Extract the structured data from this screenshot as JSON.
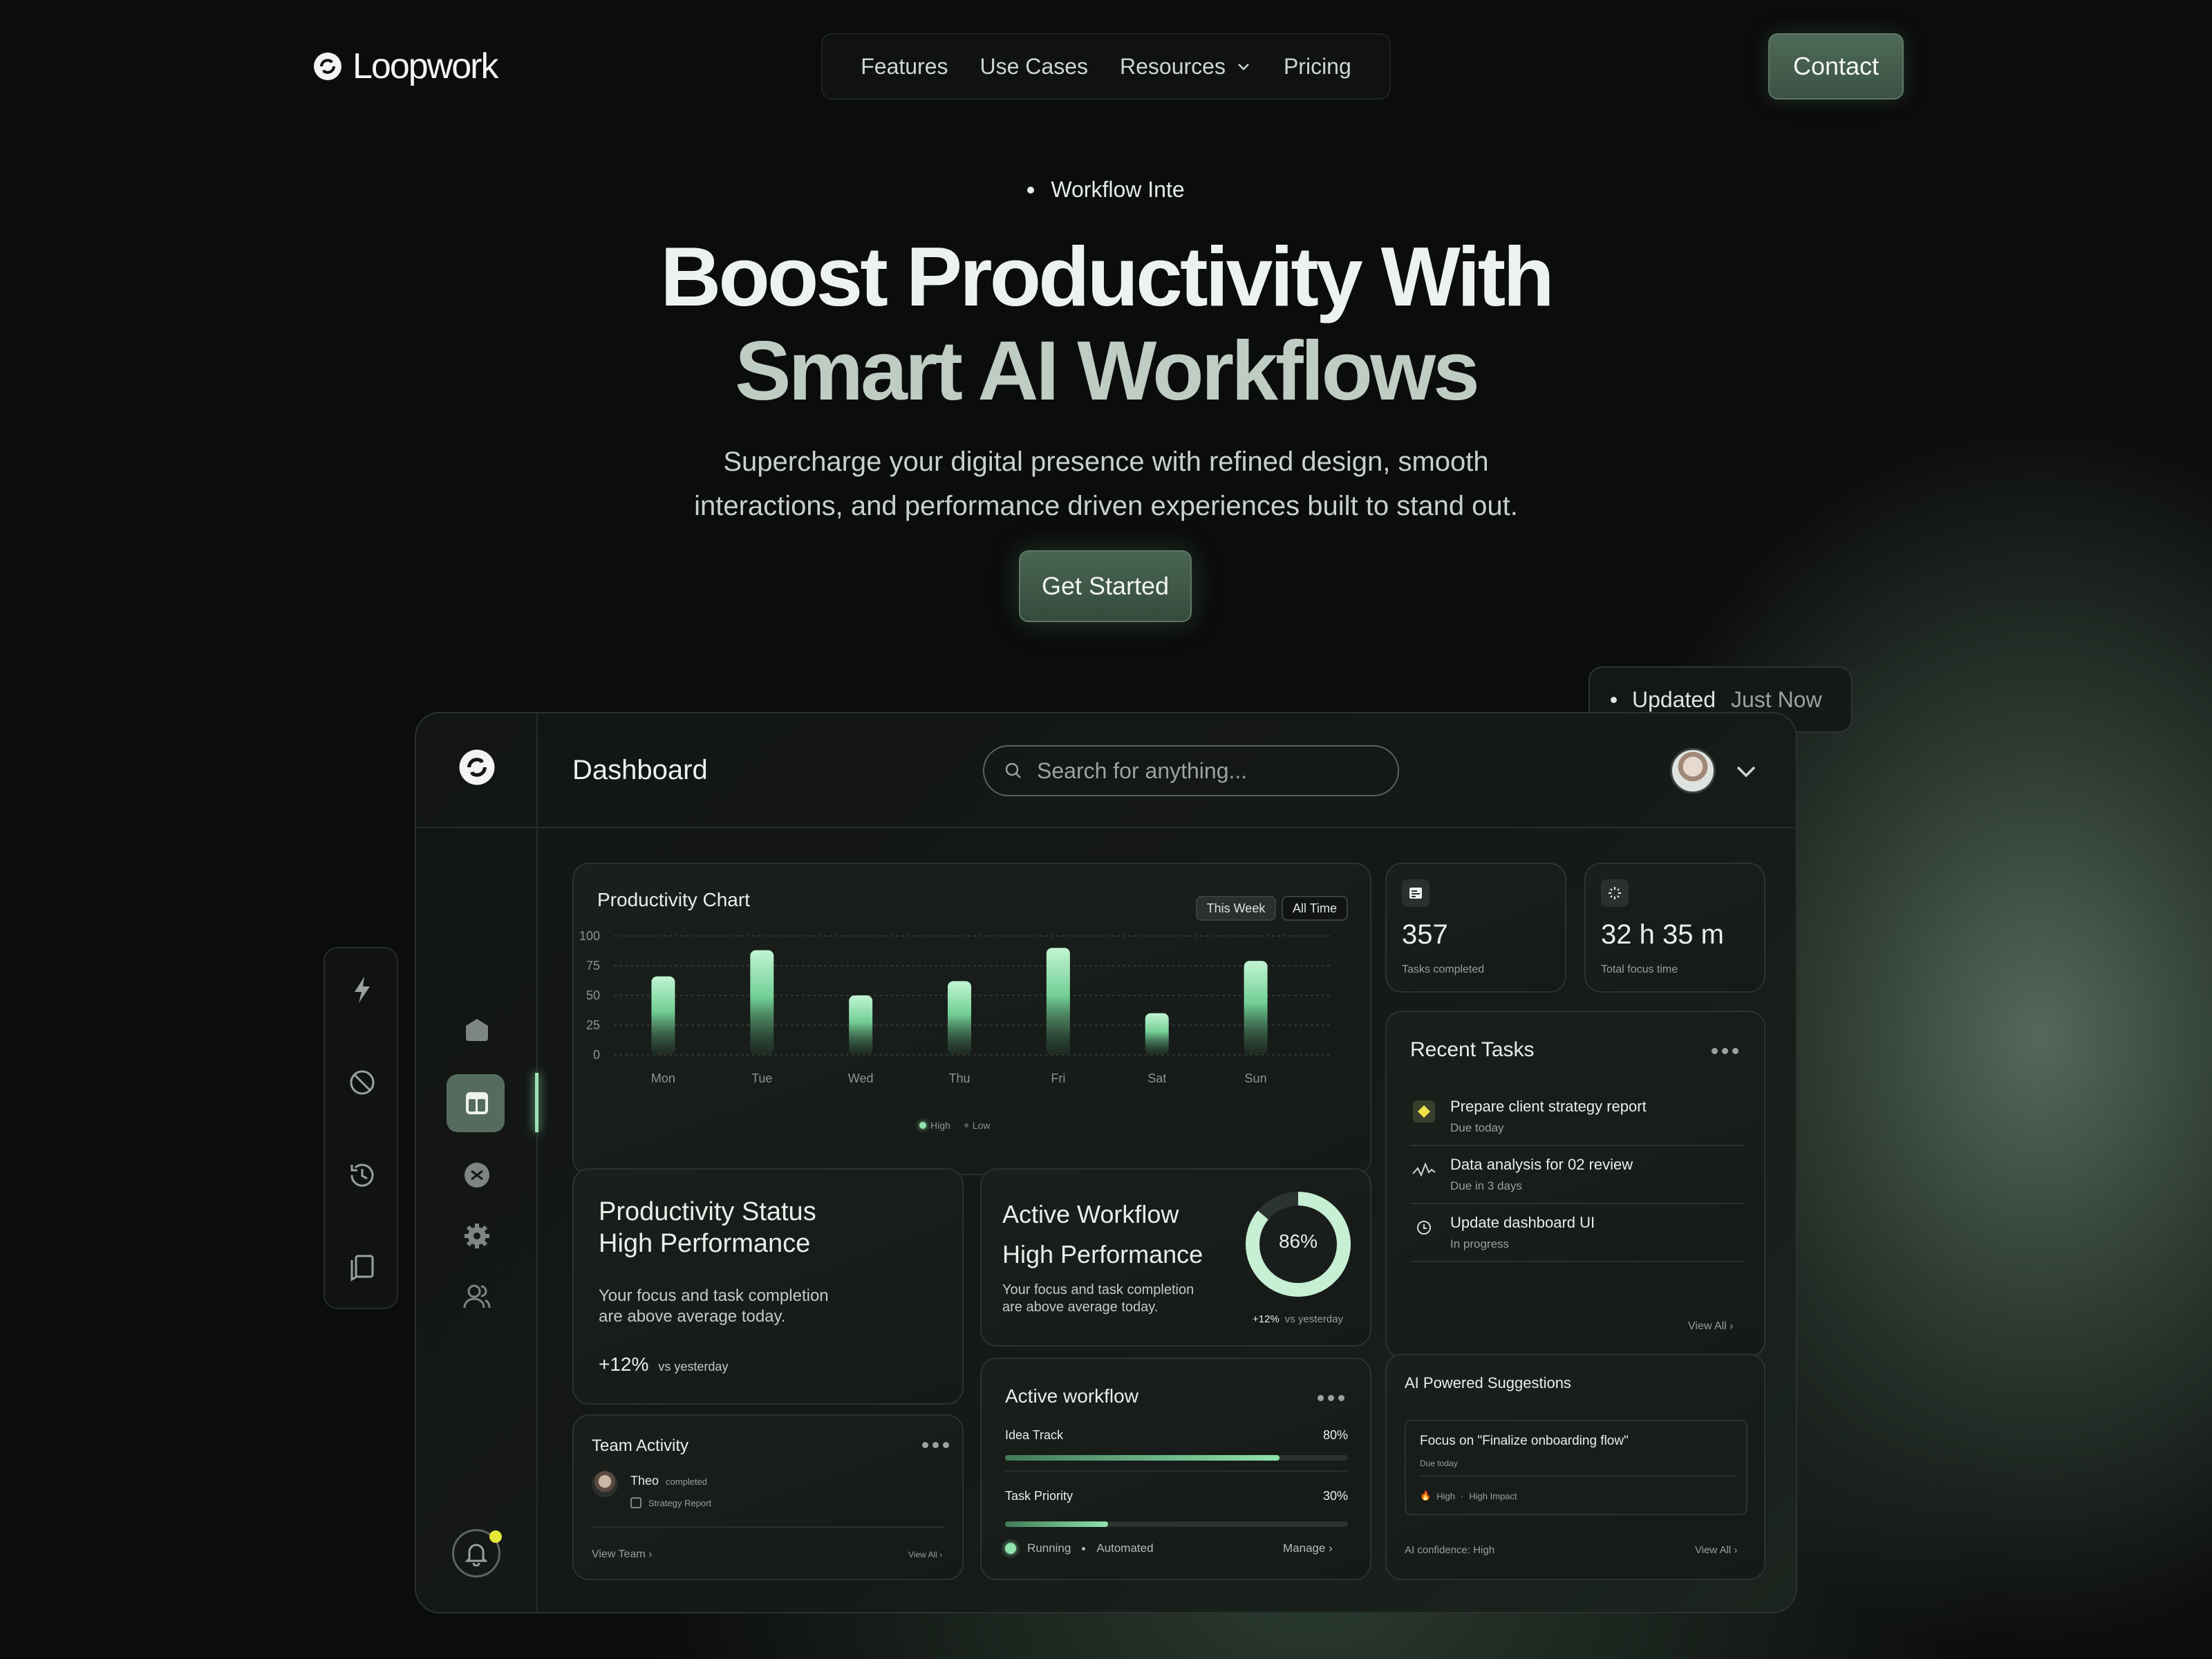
{
  "brand": {
    "name": "Loopwork"
  },
  "nav": {
    "items": [
      "Features",
      "Use Cases",
      "Resources",
      "Pricing"
    ],
    "contact": "Contact"
  },
  "hero": {
    "tag": "Workflow Inte",
    "title_line1": "Boost Productivity With",
    "title_line2": "Smart AI Workflows",
    "subtitle_line1": "Supercharge your digital presence with refined design, smooth",
    "subtitle_line2": "interactions, and performance driven experiences built to stand out.",
    "cta": "Get Started"
  },
  "updated": {
    "label": "Updated",
    "value": "Just Now"
  },
  "dashboard": {
    "title": "Dashboard",
    "search_placeholder": "Search for anything...",
    "productivity_chart": {
      "title": "Productivity Chart",
      "filters": [
        "This Week",
        "All Time"
      ],
      "legend": [
        "High",
        "Low"
      ]
    },
    "stats": [
      {
        "value": "357",
        "label": "Tasks completed"
      },
      {
        "value": "32 h 35 m",
        "label": "Total focus time"
      }
    ],
    "recent_tasks": {
      "title": "Recent Tasks",
      "view_all": "View All ›",
      "items": [
        {
          "title": "Prepare client strategy report",
          "sub": "Due today"
        },
        {
          "title": "Data analysis for 02 review",
          "sub": "Due in 3 days"
        },
        {
          "title": "Update dashboard UI",
          "sub": "In progress"
        }
      ]
    },
    "status": {
      "line1": "Productivity Status",
      "line2": "High Performance",
      "desc1": "Your focus and task completion",
      "desc2": "are above average today.",
      "delta": "+12%",
      "delta_note": "vs yesterday"
    },
    "active_workflow": {
      "line1": "Active Workflow",
      "line2": "High Performance",
      "desc1": "Your focus and task completion",
      "desc2": "are above average today.",
      "percent": "86%",
      "delta": "+12%",
      "delta_note": "vs yesterday"
    },
    "team": {
      "title": "Team Activity",
      "name": "Theo",
      "status": "completed",
      "task": "Strategy Report",
      "view_team": "View Team ›",
      "view_all": "View All ›"
    },
    "workflow": {
      "title": "Active workflow",
      "rows": [
        {
          "label": "Idea Track",
          "pct": "80%"
        },
        {
          "label": "Task Priority",
          "pct": "30%"
        }
      ],
      "status1": "Running",
      "status2": "Automated",
      "manage": "Manage ›"
    },
    "ai": {
      "title": "AI Powered Suggestions",
      "suggestion": "Focus on \"Finalize onboarding flow\"",
      "due": "Due today",
      "priority": "High",
      "impact": "High Impact",
      "confidence": "AI confidence: High",
      "view_all": "View All ›"
    }
  },
  "chart_data": {
    "type": "bar",
    "title": "Productivity Chart",
    "categories": [
      "Mon",
      "Tue",
      "Wed",
      "Thu",
      "Fri",
      "Sat",
      "Sun"
    ],
    "values": [
      66,
      88,
      50,
      62,
      90,
      35,
      79
    ],
    "ylim": [
      0,
      100
    ],
    "yticks": [
      0,
      25,
      50,
      75,
      100
    ],
    "grid": true,
    "legend": [
      "High",
      "Low"
    ],
    "legend_position": "bottom"
  },
  "workflow_progress": [
    0.8,
    0.3
  ],
  "donut_value": 0.86
}
